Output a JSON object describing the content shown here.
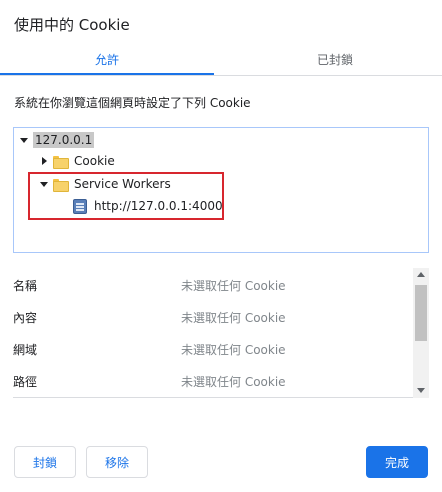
{
  "dialog": {
    "title": "使用中的 Cookie"
  },
  "tabs": [
    {
      "label": "允許"
    },
    {
      "label": "已封鎖"
    }
  ],
  "description": "系統在你瀏覽這個網頁時設定了下列 Cookie",
  "tree": {
    "host": "127.0.0.1",
    "children": [
      {
        "label": "Cookie"
      },
      {
        "label": "Service Workers",
        "children": [
          {
            "label": "http://127.0.0.1:4000"
          }
        ]
      }
    ]
  },
  "details": [
    {
      "label": "名稱",
      "value": "未選取任何 Cookie"
    },
    {
      "label": "內容",
      "value": "未選取任何 Cookie"
    },
    {
      "label": "網域",
      "value": "未選取任何 Cookie"
    },
    {
      "label": "路徑",
      "value": "未選取任何 Cookie"
    }
  ],
  "buttons": {
    "block": "封鎖",
    "remove": "移除",
    "done": "完成"
  },
  "colors": {
    "accent": "#1a73e8",
    "highlight": "#d7262e"
  }
}
